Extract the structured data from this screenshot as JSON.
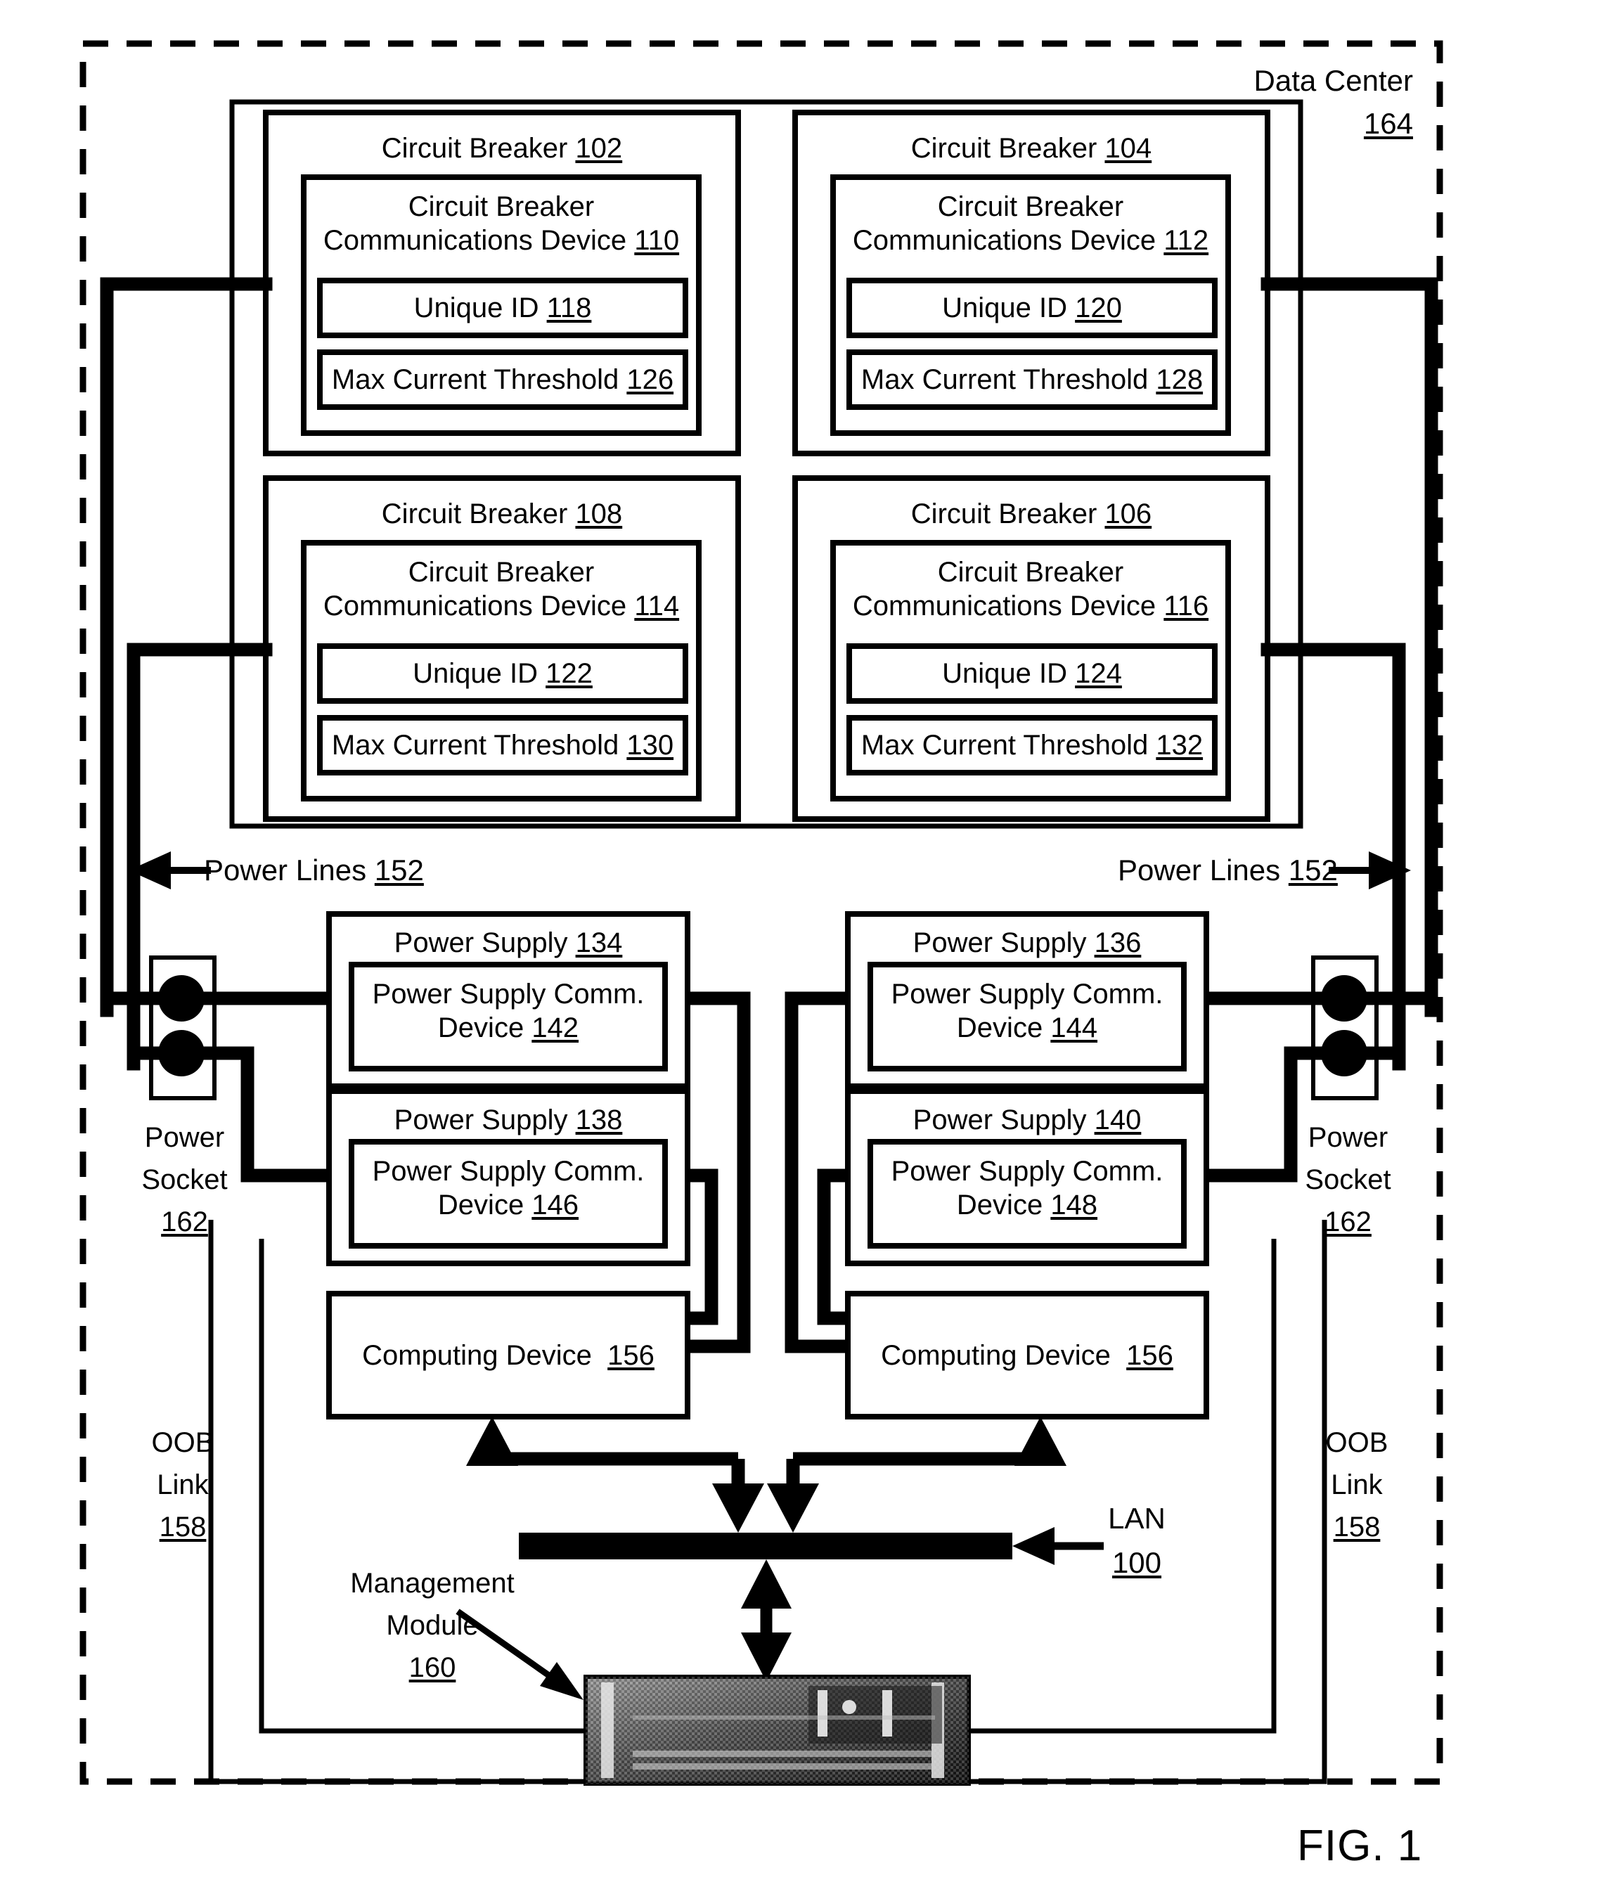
{
  "figure": {
    "caption": "FIG. 1",
    "enclosure_label_line1": "Data Center",
    "enclosure_label_ref": "164"
  },
  "circuit_breakers": [
    {
      "id": "cb-102",
      "title": "Circuit Breaker",
      "title_ref": "102",
      "comm_device_line1": "Circuit Breaker",
      "comm_device_line2": "Communications Device",
      "comm_device_ref": "110",
      "unique_id_label": "Unique ID",
      "unique_id_ref": "118",
      "max_current_label": "Max Current Threshold",
      "max_current_ref": "126"
    },
    {
      "id": "cb-104",
      "title": "Circuit Breaker",
      "title_ref": "104",
      "comm_device_line1": "Circuit Breaker",
      "comm_device_line2": "Communications Device",
      "comm_device_ref": "112",
      "unique_id_label": "Unique ID",
      "unique_id_ref": "120",
      "max_current_label": "Max Current Threshold",
      "max_current_ref": "128"
    },
    {
      "id": "cb-108",
      "title": "Circuit Breaker",
      "title_ref": "108",
      "comm_device_line1": "Circuit Breaker",
      "comm_device_line2": "Communications Device",
      "comm_device_ref": "114",
      "unique_id_label": "Unique ID",
      "unique_id_ref": "122",
      "max_current_label": "Max Current Threshold",
      "max_current_ref": "130"
    },
    {
      "id": "cb-106",
      "title": "Circuit Breaker",
      "title_ref": "106",
      "comm_device_line1": "Circuit Breaker",
      "comm_device_line2": "Communications Device",
      "comm_device_ref": "116",
      "unique_id_label": "Unique ID",
      "unique_id_ref": "124",
      "max_current_label": "Max Current Threshold",
      "max_current_ref": "132"
    }
  ],
  "power_lines": {
    "left_label": "Power Lines",
    "left_ref": "152",
    "right_label": "Power Lines",
    "right_ref": "152"
  },
  "power_supplies": [
    {
      "id": "ps-134",
      "title": "Power Supply",
      "title_ref": "134",
      "comm_line1": "Power Supply Comm.",
      "comm_line2": "Device",
      "comm_ref": "142"
    },
    {
      "id": "ps-136",
      "title": "Power Supply",
      "title_ref": "136",
      "comm_line1": "Power Supply Comm.",
      "comm_line2": "Device",
      "comm_ref": "144"
    },
    {
      "id": "ps-138",
      "title": "Power Supply",
      "title_ref": "138",
      "comm_line1": "Power Supply Comm.",
      "comm_line2": "Device",
      "comm_ref": "146"
    },
    {
      "id": "ps-140",
      "title": "Power Supply",
      "title_ref": "140",
      "comm_line1": "Power Supply Comm.",
      "comm_line2": "Device",
      "comm_ref": "148"
    }
  ],
  "power_sockets": [
    {
      "line1": "Power",
      "line2": "Socket",
      "ref": "162"
    },
    {
      "line1": "Power",
      "line2": "Socket",
      "ref": "162"
    }
  ],
  "oob_links": [
    {
      "line1": "OOB",
      "line2": "Link",
      "ref": "158"
    },
    {
      "line1": "OOB",
      "line2": "Link",
      "ref": "158"
    }
  ],
  "computing_devices": [
    {
      "label": "Computing Device",
      "ref": "156"
    },
    {
      "label": "Computing Device",
      "ref": "156"
    }
  ],
  "lan": {
    "label": "LAN",
    "ref": "100"
  },
  "management_module": {
    "line1": "Management",
    "line2": "Module",
    "ref": "160"
  },
  "colors": {
    "ink": "#000000",
    "paper": "#ffffff"
  }
}
